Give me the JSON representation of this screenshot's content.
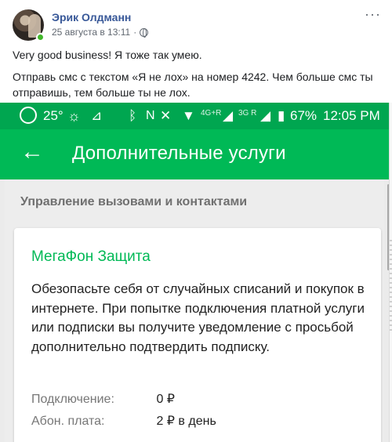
{
  "post": {
    "author": "Эрик Олдманн",
    "date": "25 августа в 13:11",
    "separator": "·",
    "more": "···",
    "paragraphs": [
      "Very good business! Я тоже так умею.",
      "Отправь смс с текстом «Я не лох» на номер 4242. Чем больше смс ты отправишь, тем больше ты не лох."
    ]
  },
  "screenshot": {
    "status_bar": {
      "temperature": "25°",
      "network_4g": "4G+R",
      "network_3g": "3G R",
      "battery": "67%",
      "time": "12:05 PM"
    },
    "app_bar": {
      "back_icon": "arrow-back-icon",
      "title": "Дополнительные услуги"
    },
    "section_title": "Управление вызовами и контактами",
    "card": {
      "title": "МегаФон Защита",
      "description": "Обезопасьте себя от случайных списаний и покупок в интернете. При попытке подключения платной услуги или подписки вы получите уведомление с просьбой дополнительно подтвердить подписку.",
      "rows": [
        {
          "label": "Подключение:",
          "value": "0 ₽"
        },
        {
          "label": "Абон. плата:",
          "value": "2 ₽ в день"
        }
      ]
    },
    "colors": {
      "status_bar": "#00a650",
      "app_bar": "#00b956",
      "accent": "#00b956"
    }
  }
}
